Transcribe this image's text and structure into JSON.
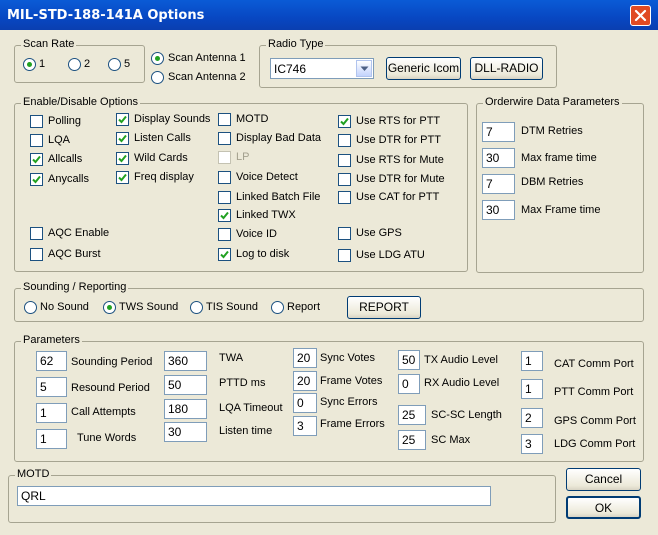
{
  "window": {
    "title": "MIL-STD-188-141A Options"
  },
  "scan_rate": {
    "label": "Scan Rate",
    "options": [
      "1",
      "2",
      "5"
    ],
    "selected": "1"
  },
  "antenna": {
    "options": [
      "Scan Antenna 1",
      "Scan Antenna 2"
    ],
    "selected": "Scan Antenna 1"
  },
  "radio_type": {
    "label": "Radio Type",
    "value": "IC746",
    "generic_button": "Generic Icom",
    "dll_button": "DLL-RADIO"
  },
  "options_group": {
    "label": "Enable/Disable Options",
    "col1": [
      {
        "label": "Polling",
        "checked": false
      },
      {
        "label": "LQA",
        "checked": false
      },
      {
        "label": "Allcalls",
        "checked": true
      },
      {
        "label": "Anycalls",
        "checked": true
      },
      {
        "label": "AQC Enable",
        "checked": false
      },
      {
        "label": "AQC Burst",
        "checked": false
      }
    ],
    "col2": [
      {
        "label": "Display Sounds",
        "checked": true
      },
      {
        "label": "Listen Calls",
        "checked": true
      },
      {
        "label": "Wild Cards",
        "checked": true
      },
      {
        "label": "Freq display",
        "checked": true
      }
    ],
    "col3": [
      {
        "label": "MOTD",
        "checked": false
      },
      {
        "label": "Display Bad Data",
        "checked": false
      },
      {
        "label": "LP",
        "checked": false,
        "disabled": true
      },
      {
        "label": "Voice Detect",
        "checked": false
      },
      {
        "label": "Linked Batch File",
        "checked": false
      },
      {
        "label": "Linked TWX",
        "checked": true
      },
      {
        "label": "Voice ID",
        "checked": false
      },
      {
        "label": "Log to disk",
        "checked": true
      }
    ],
    "col4": [
      {
        "label": "Use RTS for PTT",
        "checked": true
      },
      {
        "label": "Use DTR for PTT",
        "checked": false
      },
      {
        "label": "Use RTS for Mute",
        "checked": false
      },
      {
        "label": "Use DTR for Mute",
        "checked": false
      },
      {
        "label": "Use CAT for PTT",
        "checked": false
      },
      {
        "label": "Use GPS",
        "checked": false
      },
      {
        "label": "Use LDG ATU",
        "checked": false
      }
    ]
  },
  "orderwire": {
    "label": "Orderwire Data Parameters",
    "fields": [
      {
        "value": "7",
        "label": "DTM Retries"
      },
      {
        "value": "30",
        "label": "Max frame time"
      },
      {
        "value": "7",
        "label": "DBM Retries"
      },
      {
        "value": "30",
        "label": "Max Frame time"
      }
    ]
  },
  "sounding": {
    "label": "Sounding / Reporting",
    "options": [
      "No Sound",
      "TWS Sound",
      "TIS Sound",
      "Report"
    ],
    "selected": "TWS Sound",
    "report_button": "REPORT"
  },
  "parameters": {
    "label": "Parameters",
    "col1": [
      {
        "value": "62",
        "label": "Sounding Period"
      },
      {
        "value": "5",
        "label": "Resound Period"
      },
      {
        "value": "1",
        "label": "Call Attempts"
      },
      {
        "value": "1",
        "label": "Tune Words"
      }
    ],
    "col2": [
      {
        "value": "360",
        "label": "TWA"
      },
      {
        "value": "50",
        "label": "PTTD ms"
      },
      {
        "value": "180",
        "label": "LQA Timeout"
      },
      {
        "value": "30",
        "label": "Listen time"
      }
    ],
    "col3": [
      {
        "value": "20",
        "label": "Sync Votes"
      },
      {
        "value": "20",
        "label": "Frame Votes"
      },
      {
        "value": "0",
        "label": "Sync Errors"
      },
      {
        "value": "3",
        "label": "Frame Errors"
      }
    ],
    "col4": [
      {
        "value": "50",
        "label": "TX Audio Level"
      },
      {
        "value": "0",
        "label": "RX Audio Level"
      },
      {
        "value": "25",
        "label": "SC-SC Length"
      },
      {
        "value": "25",
        "label": "SC Max"
      }
    ],
    "col5": [
      {
        "value": "1",
        "label": "CAT Comm Port"
      },
      {
        "value": "1",
        "label": "PTT Comm Port"
      },
      {
        "value": "2",
        "label": "GPS Comm Port"
      },
      {
        "value": "3",
        "label": "LDG Comm Port"
      }
    ]
  },
  "motd": {
    "label": "MOTD",
    "value": "QRL"
  },
  "buttons": {
    "cancel": "Cancel",
    "ok": "OK"
  }
}
